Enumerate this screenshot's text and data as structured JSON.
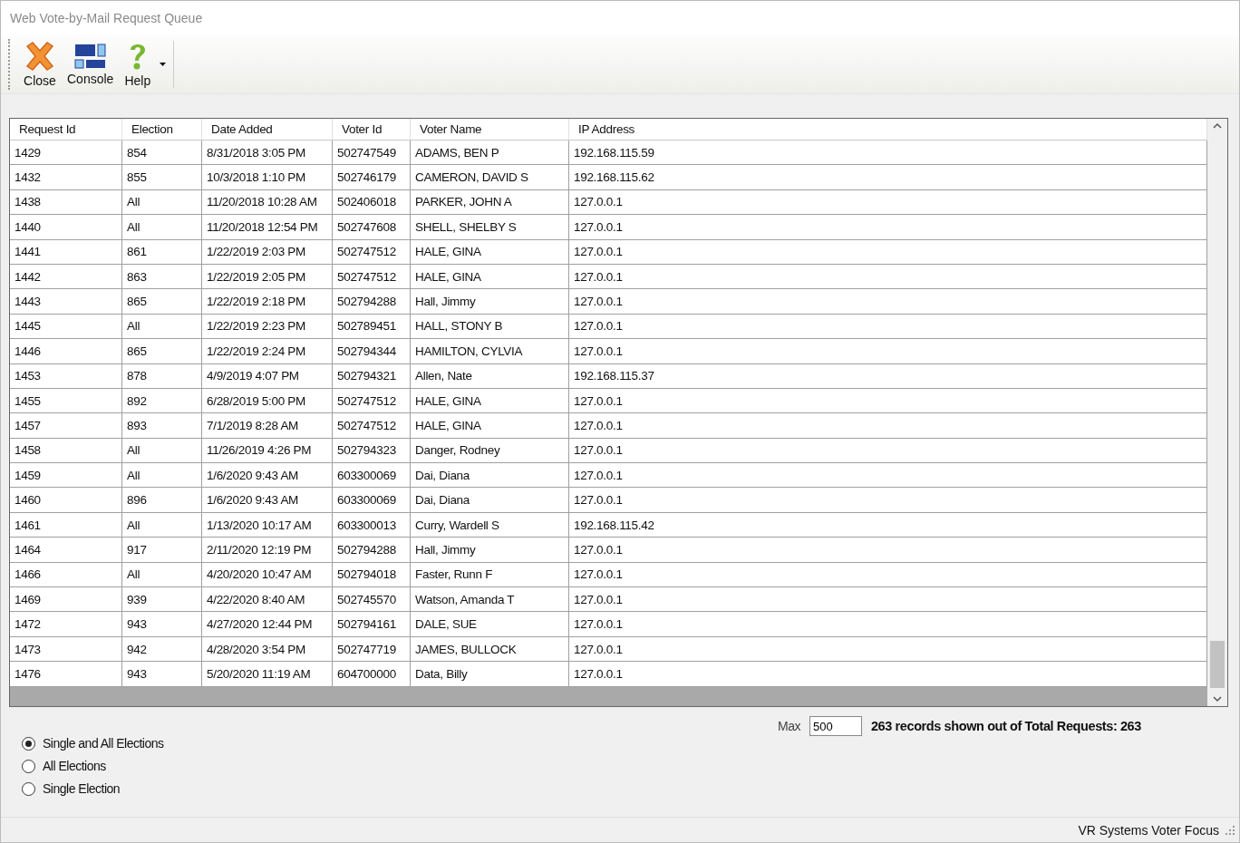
{
  "window": {
    "title": "Web Vote-by-Mail Request Queue"
  },
  "toolbar": [
    {
      "kind": "close",
      "label": "Close"
    },
    {
      "kind": "console",
      "label": "Console"
    },
    {
      "kind": "help",
      "label": "Help"
    }
  ],
  "table": {
    "columns": [
      "Request Id",
      "Election",
      "Date Added",
      "Voter Id",
      "Voter Name",
      "IP Address"
    ],
    "rows": [
      [
        "1429",
        "854",
        "8/31/2018 3:05 PM",
        "502747549",
        "ADAMS, BEN P",
        "192.168.115.59"
      ],
      [
        "1432",
        "855",
        "10/3/2018 1:10 PM",
        "502746179",
        "CAMERON, DAVID S",
        "192.168.115.62"
      ],
      [
        "1438",
        "All",
        "11/20/2018 10:28 AM",
        "502406018",
        "PARKER, JOHN A",
        "127.0.0.1"
      ],
      [
        "1440",
        "All",
        "11/20/2018 12:54 PM",
        "502747608",
        "SHELL, SHELBY S",
        "127.0.0.1"
      ],
      [
        "1441",
        "861",
        "1/22/2019 2:03 PM",
        "502747512",
        "HALE, GINA",
        "127.0.0.1"
      ],
      [
        "1442",
        "863",
        "1/22/2019 2:05 PM",
        "502747512",
        "HALE, GINA",
        "127.0.0.1"
      ],
      [
        "1443",
        "865",
        "1/22/2019 2:18 PM",
        "502794288",
        "Hall, Jimmy",
        "127.0.0.1"
      ],
      [
        "1445",
        "All",
        "1/22/2019 2:23 PM",
        "502789451",
        "HALL, STONY B",
        "127.0.0.1"
      ],
      [
        "1446",
        "865",
        "1/22/2019 2:24 PM",
        "502794344",
        "HAMILTON, CYLVIA",
        "127.0.0.1"
      ],
      [
        "1453",
        "878",
        "4/9/2019 4:07 PM",
        "502794321",
        "Allen, Nate",
        "192.168.115.37"
      ],
      [
        "1455",
        "892",
        "6/28/2019 5:00 PM",
        "502747512",
        "HALE, GINA",
        "127.0.0.1"
      ],
      [
        "1457",
        "893",
        "7/1/2019 8:28 AM",
        "502747512",
        "HALE, GINA",
        "127.0.0.1"
      ],
      [
        "1458",
        "All",
        "11/26/2019 4:26 PM",
        "502794323",
        "Danger, Rodney",
        "127.0.0.1"
      ],
      [
        "1459",
        "All",
        "1/6/2020 9:43 AM",
        "603300069",
        "Dai, Diana",
        "127.0.0.1"
      ],
      [
        "1460",
        "896",
        "1/6/2020 9:43 AM",
        "603300069",
        "Dai, Diana",
        "127.0.0.1"
      ],
      [
        "1461",
        "All",
        "1/13/2020 10:17 AM",
        "603300013",
        "Curry, Wardell S",
        "192.168.115.42"
      ],
      [
        "1464",
        "917",
        "2/11/2020 12:19 PM",
        "502794288",
        "Hall, Jimmy",
        "127.0.0.1"
      ],
      [
        "1466",
        "All",
        "4/20/2020 10:47 AM",
        "502794018",
        "Faster, Runn F",
        "127.0.0.1"
      ],
      [
        "1469",
        "939",
        "4/22/2020 8:40 AM",
        "502745570",
        "Watson, Amanda T",
        "127.0.0.1"
      ],
      [
        "1472",
        "943",
        "4/27/2020 12:44 PM",
        "502794161",
        "DALE, SUE",
        "127.0.0.1"
      ],
      [
        "1473",
        "942",
        "4/28/2020 3:54 PM",
        "502747719",
        "JAMES, BULLOCK",
        "127.0.0.1"
      ],
      [
        "1476",
        "943",
        "5/20/2020 11:19 AM",
        "604700000",
        "Data, Billy",
        "127.0.0.1"
      ]
    ]
  },
  "filter": [
    {
      "label": "Single and All Elections",
      "selected": true
    },
    {
      "label": "All Elections",
      "selected": false
    },
    {
      "label": "Single Election",
      "selected": false
    }
  ],
  "max": {
    "label": "Max",
    "value": "500"
  },
  "summary": "263 records shown out of Total Requests: 263",
  "status_bar": "VR Systems Voter Focus"
}
